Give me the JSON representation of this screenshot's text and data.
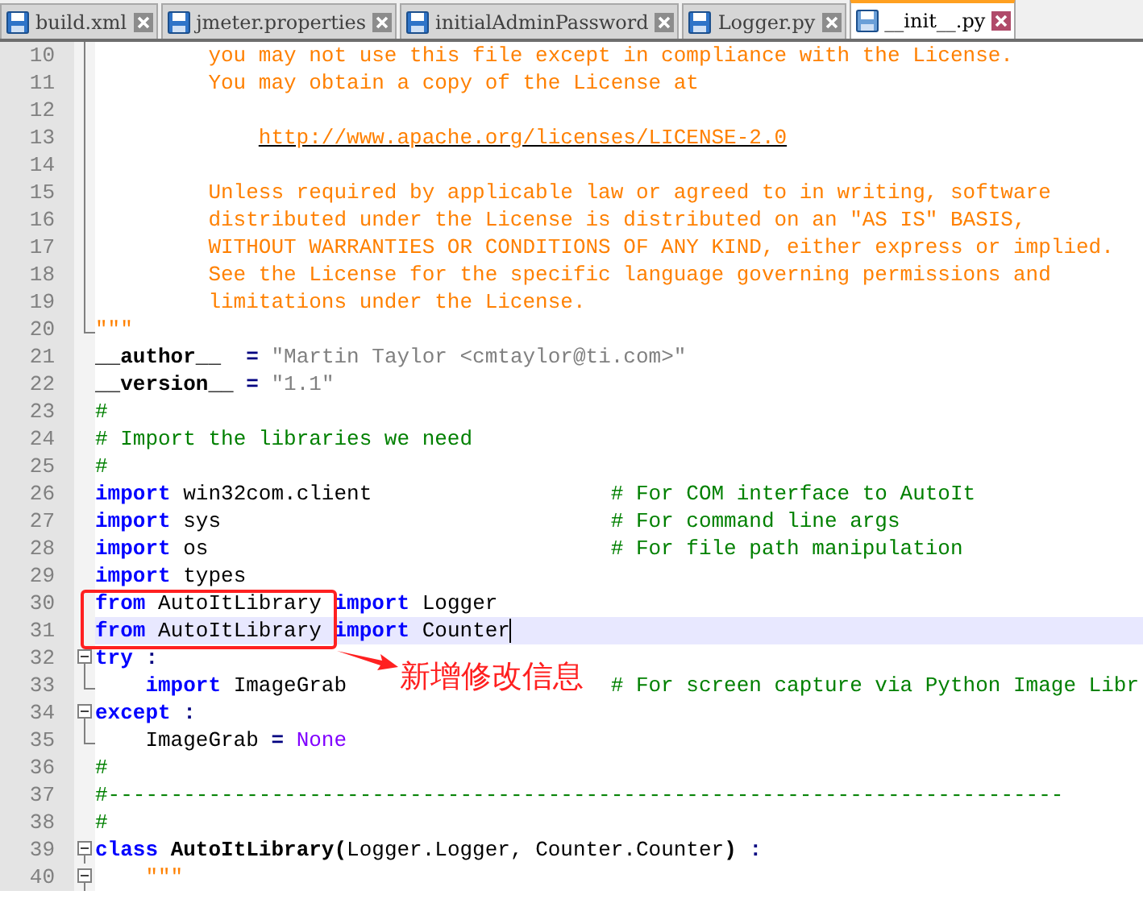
{
  "tabs": [
    {
      "label": "build.xml",
      "selected": false
    },
    {
      "label": "jmeter.properties",
      "selected": false
    },
    {
      "label": "initialAdminPassword",
      "selected": false
    },
    {
      "label": "Logger.py",
      "selected": false
    },
    {
      "label": "__init__.py",
      "selected": true
    }
  ],
  "lines": [
    {
      "number": "10",
      "kind": "docbody",
      "tokens": [
        {
          "kind": "doc",
          "text": "you may not use this file except in compliance with the License."
        }
      ]
    },
    {
      "number": "11",
      "kind": "docbody",
      "tokens": [
        {
          "kind": "doc",
          "text": "You may obtain a copy of the License at"
        }
      ]
    },
    {
      "number": "12",
      "kind": "docbody"
    },
    {
      "number": "13",
      "kind": "docbody",
      "tokens": [
        {
          "kind": "link",
          "text": "http://www.apache.org/licenses/LICENSE-2.0"
        }
      ]
    },
    {
      "number": "14",
      "kind": "docbody"
    },
    {
      "number": "15",
      "kind": "docbody",
      "tokens": [
        {
          "kind": "doc",
          "text": "Unless required by applicable law or agreed to in writing, software"
        }
      ]
    },
    {
      "number": "16",
      "kind": "docbody",
      "tokens": [
        {
          "kind": "doc",
          "text": "distributed under the License is distributed on an \"AS IS\" BASIS,"
        }
      ]
    },
    {
      "number": "17",
      "kind": "docbody",
      "tokens": [
        {
          "kind": "doc",
          "text": "WITHOUT WARRANTIES OR CONDITIONS OF ANY KIND, either express or implied."
        }
      ]
    },
    {
      "number": "18",
      "kind": "docbody",
      "tokens": [
        {
          "kind": "doc",
          "text": "See the License for the specific language governing permissions and"
        }
      ]
    },
    {
      "number": "19",
      "kind": "docbody",
      "tokens": [
        {
          "kind": "doc",
          "text": "limitations under the License."
        }
      ]
    },
    {
      "number": "20",
      "kind": "foldend",
      "tokens": [
        {
          "kind": "doc",
          "text": "\"\"\""
        }
      ]
    },
    {
      "number": "21",
      "kind": "plain",
      "tokens": [
        {
          "kind": "bold",
          "text": "__author__  "
        },
        {
          "kind": "op",
          "text": "= "
        },
        {
          "kind": "str",
          "text": "\"Martin Taylor <cmtaylor@ti.com>\""
        }
      ]
    },
    {
      "number": "22",
      "kind": "plain",
      "tokens": [
        {
          "kind": "bold",
          "text": "__version__ "
        },
        {
          "kind": "op",
          "text": "= "
        },
        {
          "kind": "str",
          "text": "\"1.1\""
        }
      ]
    },
    {
      "number": "23",
      "kind": "plain",
      "tokens": [
        {
          "kind": "comment",
          "text": "#"
        }
      ]
    },
    {
      "number": "24",
      "kind": "plain",
      "tokens": [
        {
          "kind": "comment",
          "text": "# Import the libraries we need"
        }
      ]
    },
    {
      "number": "25",
      "kind": "plain",
      "tokens": [
        {
          "kind": "comment",
          "text": "#"
        }
      ]
    },
    {
      "number": "26",
      "kind": "plain",
      "tokens": [
        {
          "kind": "kw",
          "text": "import"
        },
        {
          "kind": "text",
          "text": " win32com.client"
        }
      ],
      "comment": "# For COM interface to AutoIt"
    },
    {
      "number": "27",
      "kind": "plain",
      "tokens": [
        {
          "kind": "kw",
          "text": "import"
        },
        {
          "kind": "text",
          "text": " sys"
        }
      ],
      "comment": "# For command line args"
    },
    {
      "number": "28",
      "kind": "plain",
      "tokens": [
        {
          "kind": "kw",
          "text": "import"
        },
        {
          "kind": "text",
          "text": " os"
        }
      ],
      "comment": "# For file path manipulation"
    },
    {
      "number": "29",
      "kind": "plain",
      "tokens": [
        {
          "kind": "kw",
          "text": "import"
        },
        {
          "kind": "text",
          "text": " types"
        }
      ]
    },
    {
      "number": "30",
      "kind": "plain",
      "tokens": [
        {
          "kind": "kw",
          "text": "from"
        },
        {
          "kind": "text",
          "text": " AutoItLibrary "
        },
        {
          "kind": "kw",
          "text": "import"
        },
        {
          "kind": "text",
          "text": " Logger"
        }
      ]
    },
    {
      "number": "31",
      "kind": "plain",
      "current": true,
      "tokens": [
        {
          "kind": "kw",
          "text": "from"
        },
        {
          "kind": "text",
          "text": " AutoItLibrary "
        },
        {
          "kind": "kw",
          "text": "import"
        },
        {
          "kind": "text",
          "text": " Counter"
        }
      ]
    },
    {
      "number": "32",
      "kind": "foldstart",
      "tokens": [
        {
          "kind": "kw",
          "text": "try"
        },
        {
          "kind": "op",
          "text": " :"
        }
      ]
    },
    {
      "number": "33",
      "kind": "foldend",
      "indented": true,
      "tokens": [
        {
          "kind": "kw",
          "text": "import"
        },
        {
          "kind": "text",
          "text": " ImageGrab"
        }
      ],
      "comment": "# For screen capture via Python Image Libr"
    },
    {
      "number": "34",
      "kind": "foldstart",
      "tokens": [
        {
          "kind": "kw",
          "text": "except"
        },
        {
          "kind": "op",
          "text": " :"
        }
      ]
    },
    {
      "number": "35",
      "kind": "foldend",
      "indented": true,
      "tokens": [
        {
          "kind": "text",
          "text": "ImageGrab "
        },
        {
          "kind": "op",
          "text": "= "
        },
        {
          "kind": "const",
          "text": "None"
        }
      ]
    },
    {
      "number": "36",
      "kind": "plain",
      "tokens": [
        {
          "kind": "comment",
          "text": "#"
        }
      ]
    },
    {
      "number": "37",
      "kind": "plain",
      "tokens": [
        {
          "kind": "comment",
          "text": "#----------------------------------------------------------------------------"
        }
      ]
    },
    {
      "number": "38",
      "kind": "plain",
      "tokens": [
        {
          "kind": "comment",
          "text": "#"
        }
      ]
    },
    {
      "number": "39",
      "kind": "foldstart",
      "tokens": [
        {
          "kind": "kw",
          "text": "class"
        },
        {
          "kind": "bold",
          "text": " AutoItLibrary("
        },
        {
          "kind": "text",
          "text": "Logger.Logger, Counter.Counter"
        },
        {
          "kind": "bold",
          "text": ")"
        },
        {
          "kind": "op",
          "text": " :"
        }
      ]
    },
    {
      "number": "40",
      "kind": "foldstart",
      "indented": true,
      "tokens": [
        {
          "kind": "doc",
          "text": "\"\"\""
        }
      ]
    }
  ],
  "annotation": {
    "text": "新增修改信息"
  }
}
